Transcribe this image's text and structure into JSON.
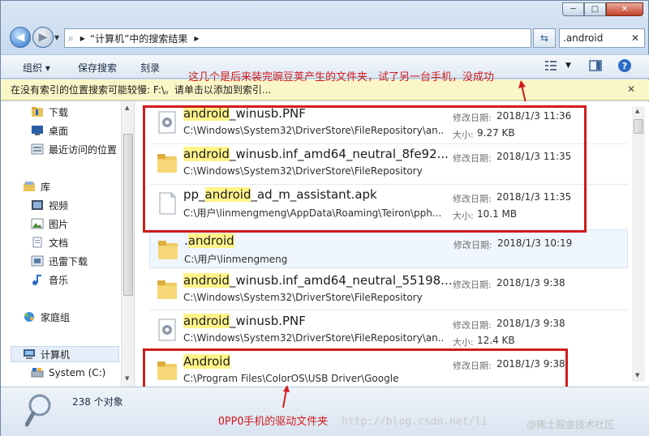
{
  "window": {
    "minimize": "─",
    "maximize": "□",
    "close": "✕"
  },
  "address": {
    "breadcrumb": "“计算机”中的搜索结果",
    "search_value": ".android"
  },
  "toolbar": {
    "organize": "组织 ▾",
    "save_search": "保存搜索",
    "burn": "刻录"
  },
  "infobar": {
    "text": "在没有索引的位置搜索可能较慢: F:\\。请单击以添加到索引...",
    "close": "✕"
  },
  "annotations": {
    "top": "这几个是后来装完豌豆荚产生的文件夹，试了另一台手机，没成功",
    "bottom": "OPPO手机的驱动文件夹"
  },
  "nav": {
    "items": [
      {
        "label": "下载"
      },
      {
        "label": "桌面"
      },
      {
        "label": "最近访问的位置"
      },
      {
        "label": "库"
      },
      {
        "label": "视频"
      },
      {
        "label": "图片"
      },
      {
        "label": "文档"
      },
      {
        "label": "迅雷下载"
      },
      {
        "label": "音乐"
      },
      {
        "label": "家庭组"
      },
      {
        "label": "计算机"
      },
      {
        "label": "System (C:)"
      }
    ]
  },
  "results": [
    {
      "name_hl": "android",
      "name_pre": "",
      "name_post": "_winusb.PNF",
      "path": "C:\\Windows\\System32\\DriverStore\\FileRepository\\an...",
      "date_label": "修改日期:",
      "date": "2018/1/3 11:36",
      "size_label": "大小:",
      "size": "9.27 KB",
      "icon": "settings-file-icon"
    },
    {
      "name_hl": "android",
      "name_pre": "",
      "name_post": "_winusb.inf_amd64_neutral_8fe92...",
      "path": "C:\\Windows\\System32\\DriverStore\\FileRepository",
      "date_label": "修改日期:",
      "date": "2018/1/3 11:35",
      "size_label": "",
      "size": "",
      "icon": "folder-icon"
    },
    {
      "name_hl": "android",
      "name_pre": "pp_",
      "name_post": "_ad_m_assistant.apk",
      "path": "C:\\用户\\linmengmeng\\AppData\\Roaming\\Teiron\\pph...",
      "date_label": "修改日期:",
      "date": "2018/1/3 11:35",
      "size_label": "大小:",
      "size": "10.1 MB",
      "icon": "file-icon"
    },
    {
      "name_hl": "android",
      "name_pre": ".",
      "name_post": "",
      "path": "C:\\用户\\linmengmeng",
      "date_label": "修改日期:",
      "date": "2018/1/3 10:19",
      "size_label": "",
      "size": "",
      "icon": "folder-icon"
    },
    {
      "name_hl": "android",
      "name_pre": "",
      "name_post": "_winusb.inf_amd64_neutral_55198...",
      "path": "C:\\Windows\\System32\\DriverStore\\FileRepository",
      "date_label": "修改日期:",
      "date": "2018/1/3 9:38",
      "size_label": "",
      "size": "",
      "icon": "folder-icon"
    },
    {
      "name_hl": "android",
      "name_pre": "",
      "name_post": "_winusb.PNF",
      "path": "C:\\Windows\\System32\\DriverStore\\FileRepository\\an...",
      "date_label": "修改日期:",
      "date": "2018/1/3 9:38",
      "size_label": "大小:",
      "size": "12.4 KB",
      "icon": "settings-file-icon"
    },
    {
      "name_hl": "Android",
      "name_pre": "",
      "name_post": "",
      "path": "C:\\Program Files\\ColorOS\\USB Driver\\Google",
      "date_label": "修改日期:",
      "date": "2018/1/3 9:38",
      "size_label": "",
      "size": "",
      "icon": "folder-icon"
    }
  ],
  "details": {
    "count": "238 个对象"
  },
  "watermark": {
    "url": "http://blog.csdn.net/li",
    "site": "@稀土掘金技术社区"
  },
  "colors": {
    "annotation": "#d01c1c",
    "highlight": "#fff38a"
  }
}
